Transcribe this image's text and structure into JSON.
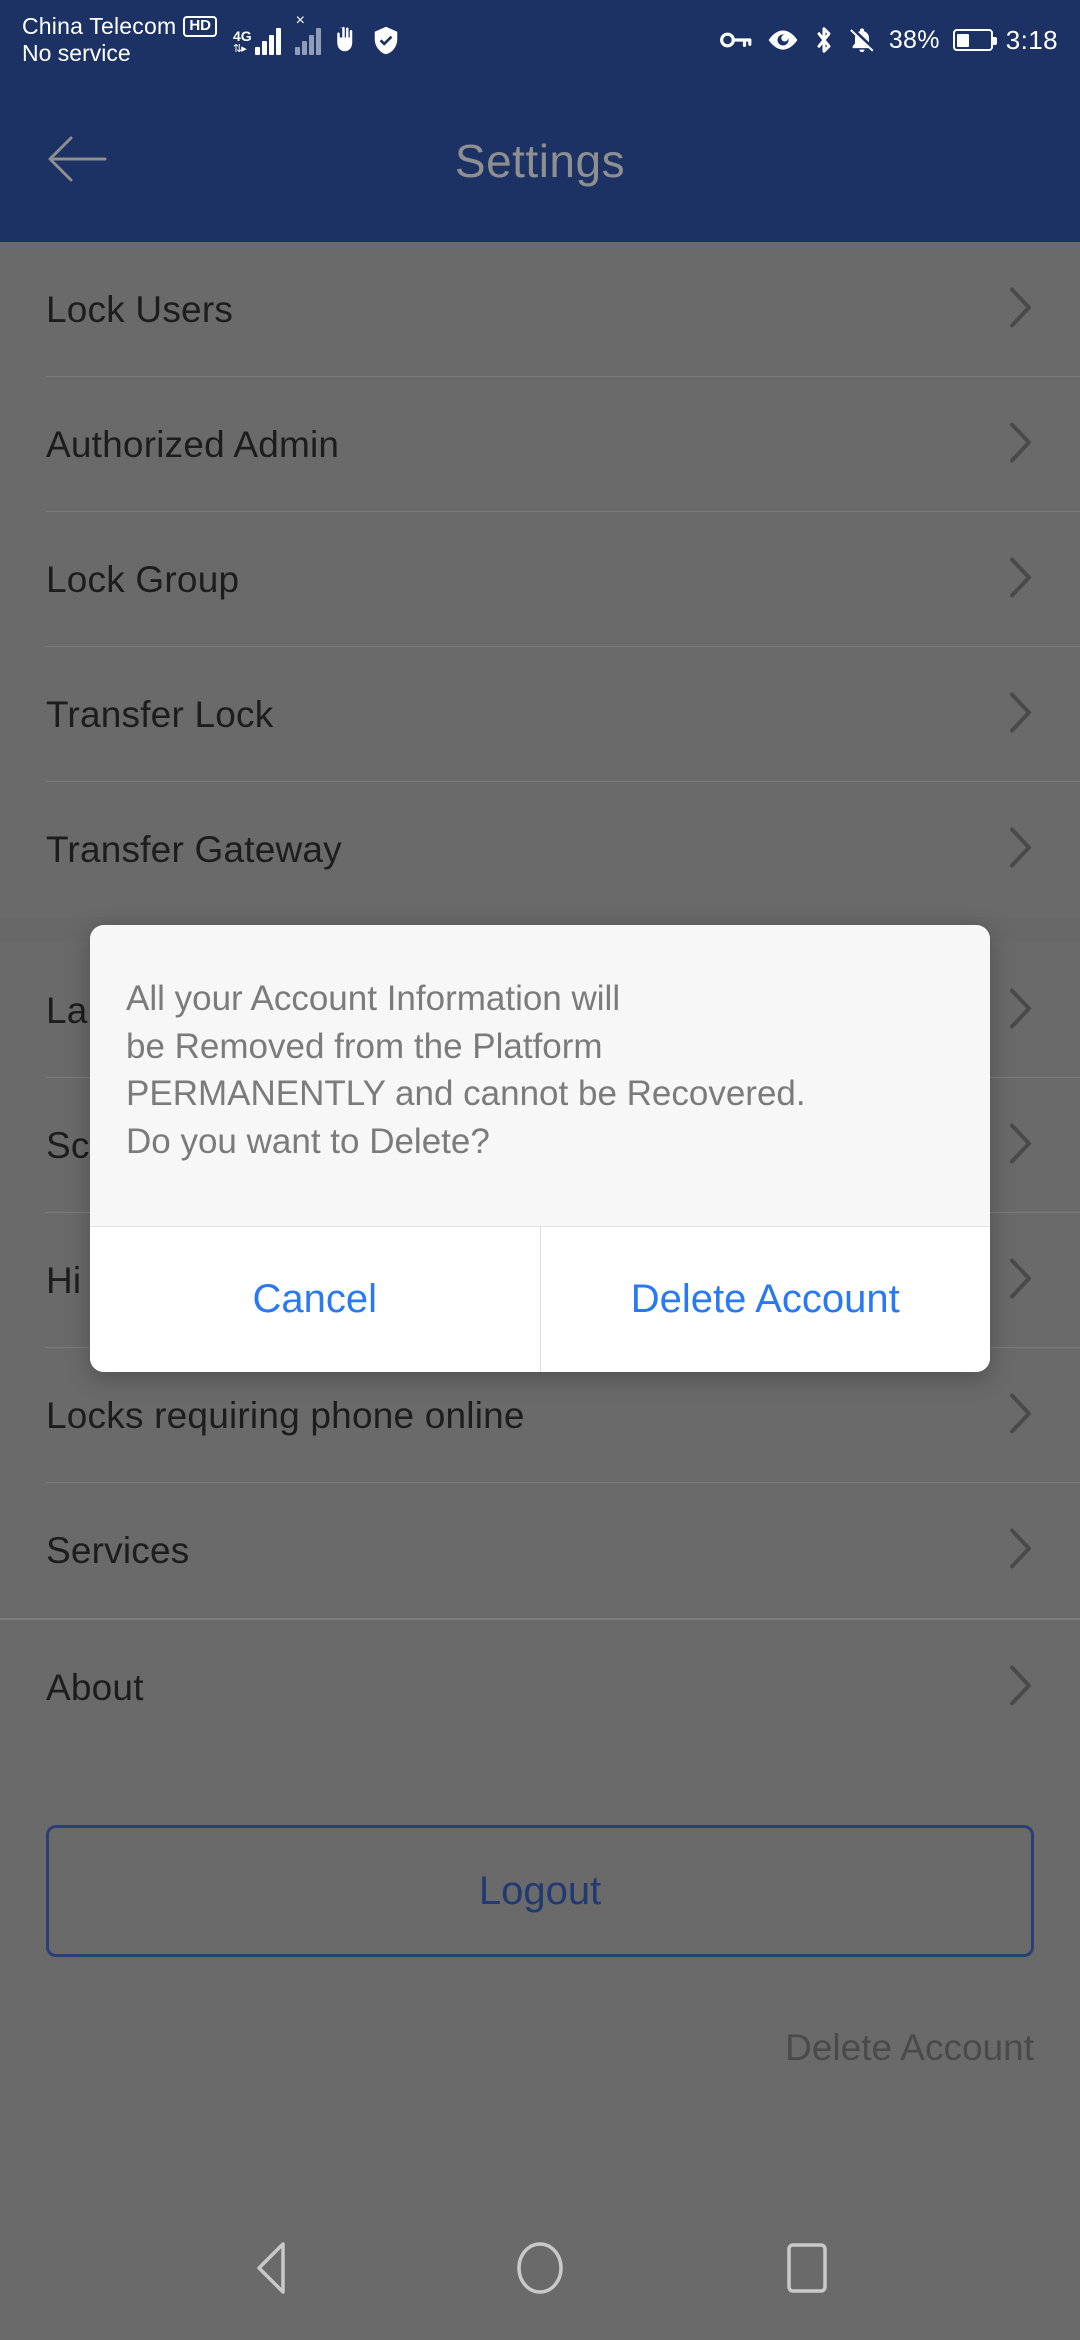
{
  "status_bar": {
    "carrier": "China Telecom",
    "hd_badge": "HD",
    "no_service": "No service",
    "network_type": "4G",
    "battery_percent": "38%",
    "clock": "3:18",
    "icons": [
      "signal-4g-icon",
      "signal-sim2-no-service-icon",
      "hand-key-icon",
      "shield-check-icon",
      "key-icon",
      "eye-icon",
      "bluetooth-icon",
      "bell-muted-icon",
      "battery-icon"
    ]
  },
  "app_bar": {
    "title": "Settings",
    "back_icon": "arrow-left-icon"
  },
  "settings": {
    "group_one": [
      {
        "label": "Lock Users"
      },
      {
        "label": "Authorized Admin"
      },
      {
        "label": "Lock Group"
      },
      {
        "label": "Transfer Lock"
      },
      {
        "label": "Transfer Gateway"
      }
    ],
    "group_two": [
      {
        "label": "La"
      },
      {
        "label": "Sc"
      },
      {
        "label": "Hi"
      },
      {
        "label": "Locks requiring phone online"
      },
      {
        "label": "Services"
      }
    ],
    "group_three": [
      {
        "label": "About"
      }
    ],
    "chevron_icon": "chevron-right-icon"
  },
  "footer": {
    "logout_label": "Logout",
    "delete_account_label": "Delete Account"
  },
  "dialog": {
    "message": "All your Account Information will\nbe Removed from the Platform\nPERMANENTLY and cannot be Recovered.\nDo you want to Delete?",
    "cancel_label": "Cancel",
    "confirm_label": "Delete Account"
  },
  "nav_bar": {
    "back_icon": "triangle-back-icon",
    "home_icon": "circle-home-icon",
    "recents_icon": "square-recents-icon"
  },
  "colors": {
    "header": "#1c3264",
    "accent_blue": "#2979f2",
    "logout_border": "#2a3f74",
    "scrim": "#6a6a6a"
  }
}
